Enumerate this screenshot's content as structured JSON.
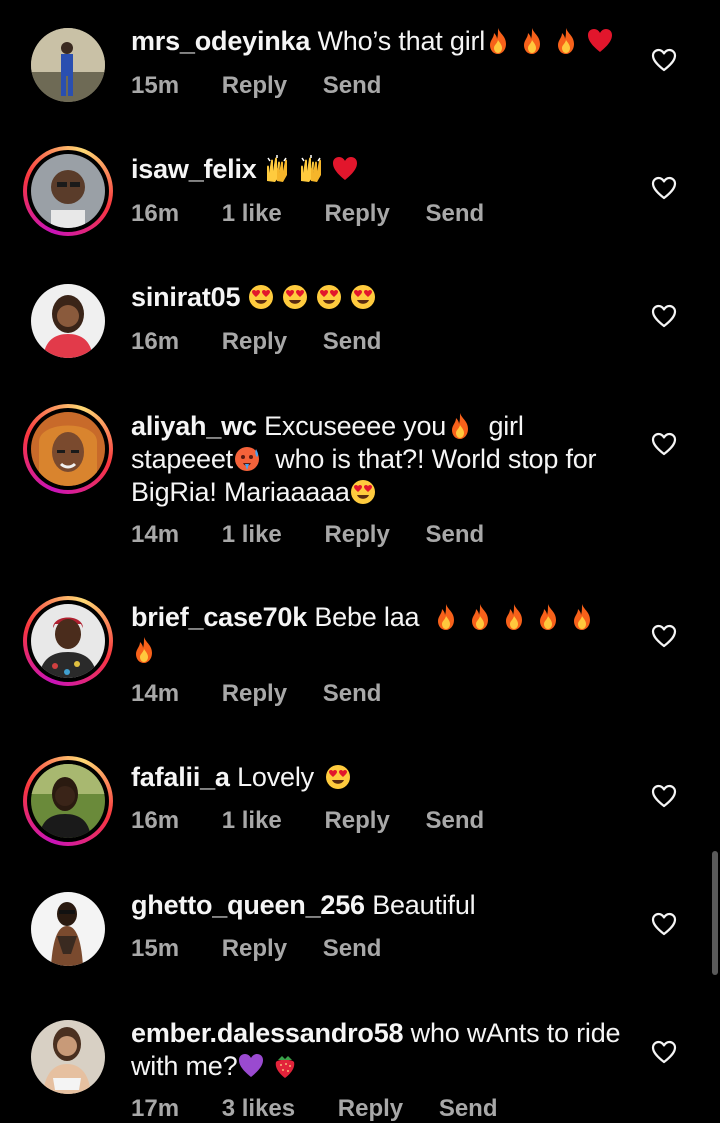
{
  "colors": {
    "background": "#000000",
    "text": "#f5f5f5",
    "meta": "#a8a8a8"
  },
  "comments": [
    {
      "username": "mrs_odeyinka",
      "text": "Who’s that girl",
      "emojis": [
        "fire",
        "fire",
        "fire",
        "red-heart"
      ],
      "time": "15m",
      "likes": "",
      "reply": "Reply",
      "send": "Send",
      "story_ring": false
    },
    {
      "username": "isaw_felix",
      "text": "",
      "emojis": [
        "raising-hands",
        "raising-hands",
        "red-heart"
      ],
      "time": "16m",
      "likes": "1 like",
      "reply": "Reply",
      "send": "Send",
      "story_ring": true
    },
    {
      "username": "sinirat05",
      "text": "",
      "emojis": [
        "heart-eyes",
        "heart-eyes",
        "heart-eyes",
        "heart-eyes"
      ],
      "time": "16m",
      "likes": "",
      "reply": "Reply",
      "send": "Send",
      "story_ring": false
    },
    {
      "username": "aliyah_wc",
      "text_parts": [
        "Excuseeee you",
        "girl stapeeet",
        "who is that?! World stop for BigRia! Mariaaaaa"
      ],
      "time": "14m",
      "likes": "1 like",
      "reply": "Reply",
      "send": "Send",
      "story_ring": true
    },
    {
      "username": "brief_case70k",
      "text": "Bebe laa",
      "emojis": [
        "fire",
        "fire",
        "fire",
        "fire",
        "fire",
        "fire"
      ],
      "time": "14m",
      "likes": "",
      "reply": "Reply",
      "send": "Send",
      "story_ring": true
    },
    {
      "username": "fafalii_a",
      "text": "Lovely",
      "emojis": [
        "heart-eyes"
      ],
      "time": "16m",
      "likes": "1 like",
      "reply": "Reply",
      "send": "Send",
      "story_ring": true
    },
    {
      "username": "ghetto_queen_256",
      "text": "Beautiful",
      "emojis": [],
      "time": "15m",
      "likes": "",
      "reply": "Reply",
      "send": "Send",
      "story_ring": false
    },
    {
      "username": "ember.dalessandro58",
      "text": "who wAnts to ride with me?",
      "emojis": [
        "purple-heart",
        "strawberry"
      ],
      "time": "17m",
      "likes": "3 likes",
      "reply": "Reply",
      "send": "Send",
      "story_ring": false
    }
  ]
}
